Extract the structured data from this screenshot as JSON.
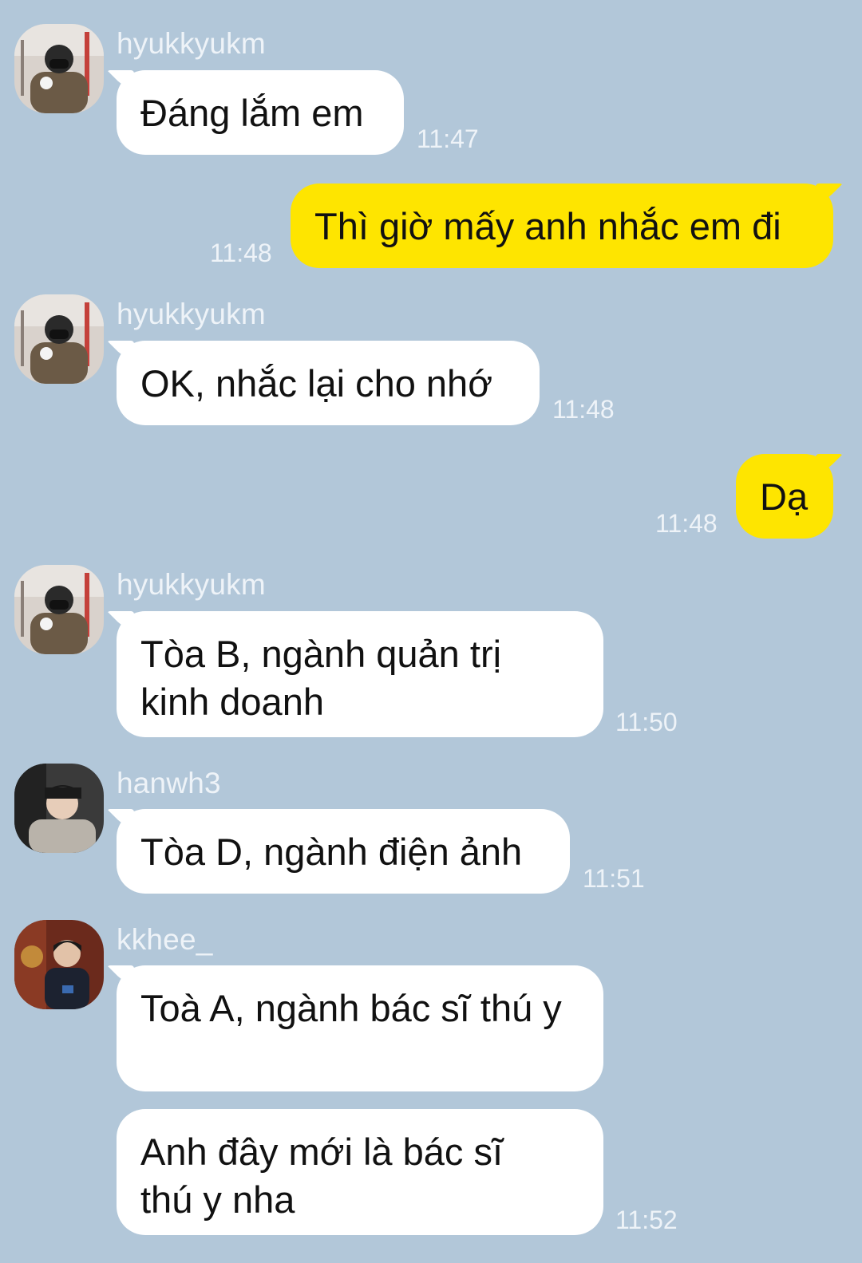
{
  "messages": [
    {
      "sender": "hyukkyukm",
      "text": "Đáng lắm em",
      "time": "11:47"
    },
    {
      "text": "Thì giờ mấy anh nhắc em đi",
      "time": "11:48"
    },
    {
      "sender": "hyukkyukm",
      "text": "OK, nhắc lại cho nhớ",
      "time": "11:48"
    },
    {
      "text": "Dạ",
      "time": "11:48"
    },
    {
      "sender": "hyukkyukm",
      "text": "Tòa B, ngành quản trị kinh doanh",
      "time": "11:50"
    },
    {
      "sender": "hanwh3",
      "text": "Tòa D, ngành điện ảnh",
      "time": "11:51"
    },
    {
      "sender": "kkhee_",
      "text": "Toà A, ngành bác sĩ thú y"
    },
    {
      "text": "Anh đây mới là bác sĩ thú y nha",
      "time": "11:52"
    }
  ],
  "colors": {
    "background": "#b2c7d9",
    "incoming_bubble": "#ffffff",
    "outgoing_bubble": "#fee500",
    "meta_text": "#eef3f8"
  }
}
